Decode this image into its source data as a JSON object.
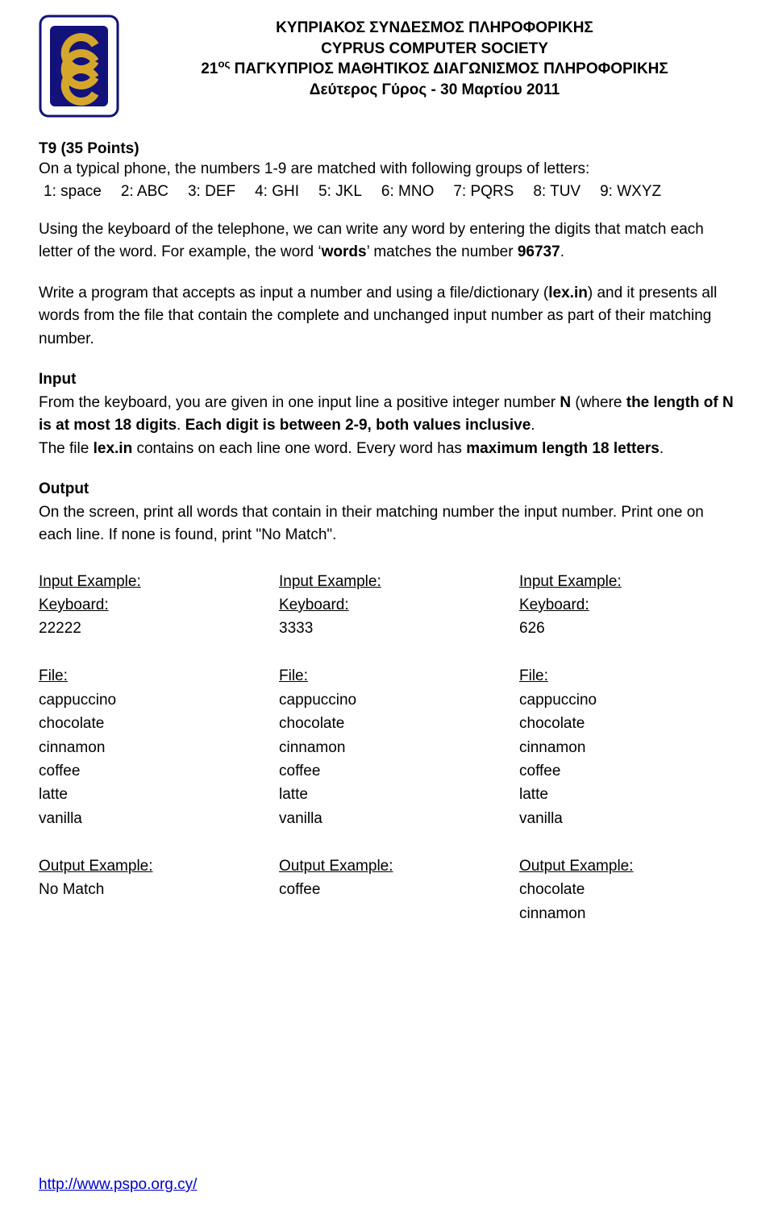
{
  "header": {
    "line1": "ΚΥΠΡΙΑΚΟΣ ΣΥΝΔΕΣΜΟΣ ΠΛΗΡΟΦΟΡΙΚΗΣ",
    "line2": "CYPRUS COMPUTER SOCIETY",
    "line3_prefix": "21",
    "line3_sup": "ος",
    "line3_rest": " ΠΑΓΚΥΠΡΙΟΣ ΜΑΘΗΤΙΚΟΣ ΔΙΑΓΩΝΙΣΜΟΣ ΠΛΗΡΟΦΟΡΙΚΗΣ",
    "line4": "Δεύτερος Γύρος - 30 Μαρτίου 2011"
  },
  "title": "T9 (35 Points)",
  "intro": "On a typical phone, the numbers 1-9 are matched with following groups of letters:",
  "keymap": [
    "1: space",
    "2: ABC",
    "3: DEF",
    "4: GHI",
    "5: JKL",
    "6: MNO",
    "7: PQRS",
    "8: TUV",
    "9: WXYZ"
  ],
  "p2a": "Using the keyboard of the telephone, we can write any word by entering the digits that match each letter of the word. For example, the word ‘",
  "p2b_word": "words",
  "p2c": "’ matches the number ",
  "p2d_num": "96737",
  "p2e": ".",
  "p3a": "Write a program that accepts as input a number and using a file/dictionary (",
  "p3b_file": "lex.in",
  "p3c": ") and it presents all words from the file that contain the complete and unchanged input number as part of their matching number.",
  "input_heading": "Input",
  "input_1a": "From the keyboard, you are given in one input line a positive integer number ",
  "input_1n": "N",
  "input_1b": " (where ",
  "input_1c": "the length of N is at most 18 digits",
  "input_1d": ". ",
  "input_1e": "Each digit is between 2-9, both values inclusive",
  "input_1f": ".",
  "input_2a": "The file ",
  "input_2b": "lex.in",
  "input_2c": " contains on each line one word. Every word has ",
  "input_2d": "maximum length 18 letters",
  "input_2e": ".",
  "output_heading": "Output",
  "output_text": "On the screen, print all words that contain in their matching number the input number. Print one on each line. If none is found, print \"No Match\".",
  "labels": {
    "input_example": "Input Example:",
    "keyboard": "Keyboard:",
    "file": "File:",
    "output_example": "Output Example:"
  },
  "examples": [
    {
      "keyboard": "22222",
      "file": [
        "cappuccino",
        "chocolate",
        "cinnamon",
        "coffee",
        "latte",
        "vanilla"
      ],
      "output": [
        "No Match"
      ]
    },
    {
      "keyboard": "3333",
      "file": [
        "cappuccino",
        "chocolate",
        "cinnamon",
        "coffee",
        "latte",
        "vanilla"
      ],
      "output": [
        "coffee"
      ]
    },
    {
      "keyboard": "626",
      "file": [
        "cappuccino",
        "chocolate",
        "cinnamon",
        "coffee",
        "latte",
        "vanilla"
      ],
      "output": [
        "chocolate",
        "cinnamon"
      ]
    }
  ],
  "footer_link": "http://www.pspo.org.cy/"
}
